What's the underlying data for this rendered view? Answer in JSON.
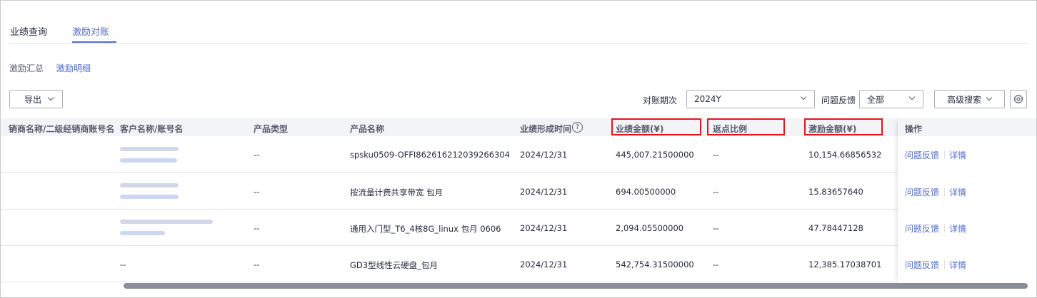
{
  "tabs": [
    {
      "label": "业绩查询",
      "active": false
    },
    {
      "label": "激励对账",
      "active": true
    }
  ],
  "subnav": {
    "summary": "激励汇总",
    "detail": "激励明细"
  },
  "toolbar": {
    "export_label": "导出",
    "period_label": "对账期次",
    "period_value": "2024Y",
    "feedback_label": "问题反馈",
    "feedback_value": "全部",
    "advanced_search_label": "高级搜索",
    "settings_icon": "gear-icon"
  },
  "table": {
    "columns": [
      "销商名称/二级经销商账号名",
      "客户名称/账号名",
      "产品类型",
      "产品名称",
      "业绩形成时间",
      "业绩金额(¥)",
      "返点比例",
      "激励金额(¥)",
      "操作"
    ],
    "help_icon": "?",
    "rows": [
      {
        "customer": "",
        "product_type": "--",
        "product_name": "spsku0509-OFFI862616212039266304",
        "time": "2024/12/31",
        "amount": "445,007.21500000",
        "rebate": "--",
        "incentive": "10,154.66856532"
      },
      {
        "customer": "",
        "product_type": "--",
        "product_name": "按流量计费共享带宽 包月",
        "time": "2024/12/31",
        "amount": "694.00500000",
        "rebate": "--",
        "incentive": "15.83657640"
      },
      {
        "customer": "",
        "product_type": "--",
        "product_name": "通用入门型_T6_4核8G_linux 包月 0606",
        "time": "2024/12/31",
        "amount": "2,094.05500000",
        "rebate": "--",
        "incentive": "47.78447128"
      },
      {
        "customer": "--",
        "product_type": "--",
        "product_name": "GD3型线性云硬盘_包月",
        "time": "2024/12/31",
        "amount": "542,754.31500000",
        "rebate": "--",
        "incentive": "12,385.17038701"
      }
    ],
    "actions": {
      "feedback": "问题反馈",
      "detail": "详情"
    }
  },
  "colors": {
    "accent": "#526ecc",
    "highlight": "#e6131d"
  }
}
